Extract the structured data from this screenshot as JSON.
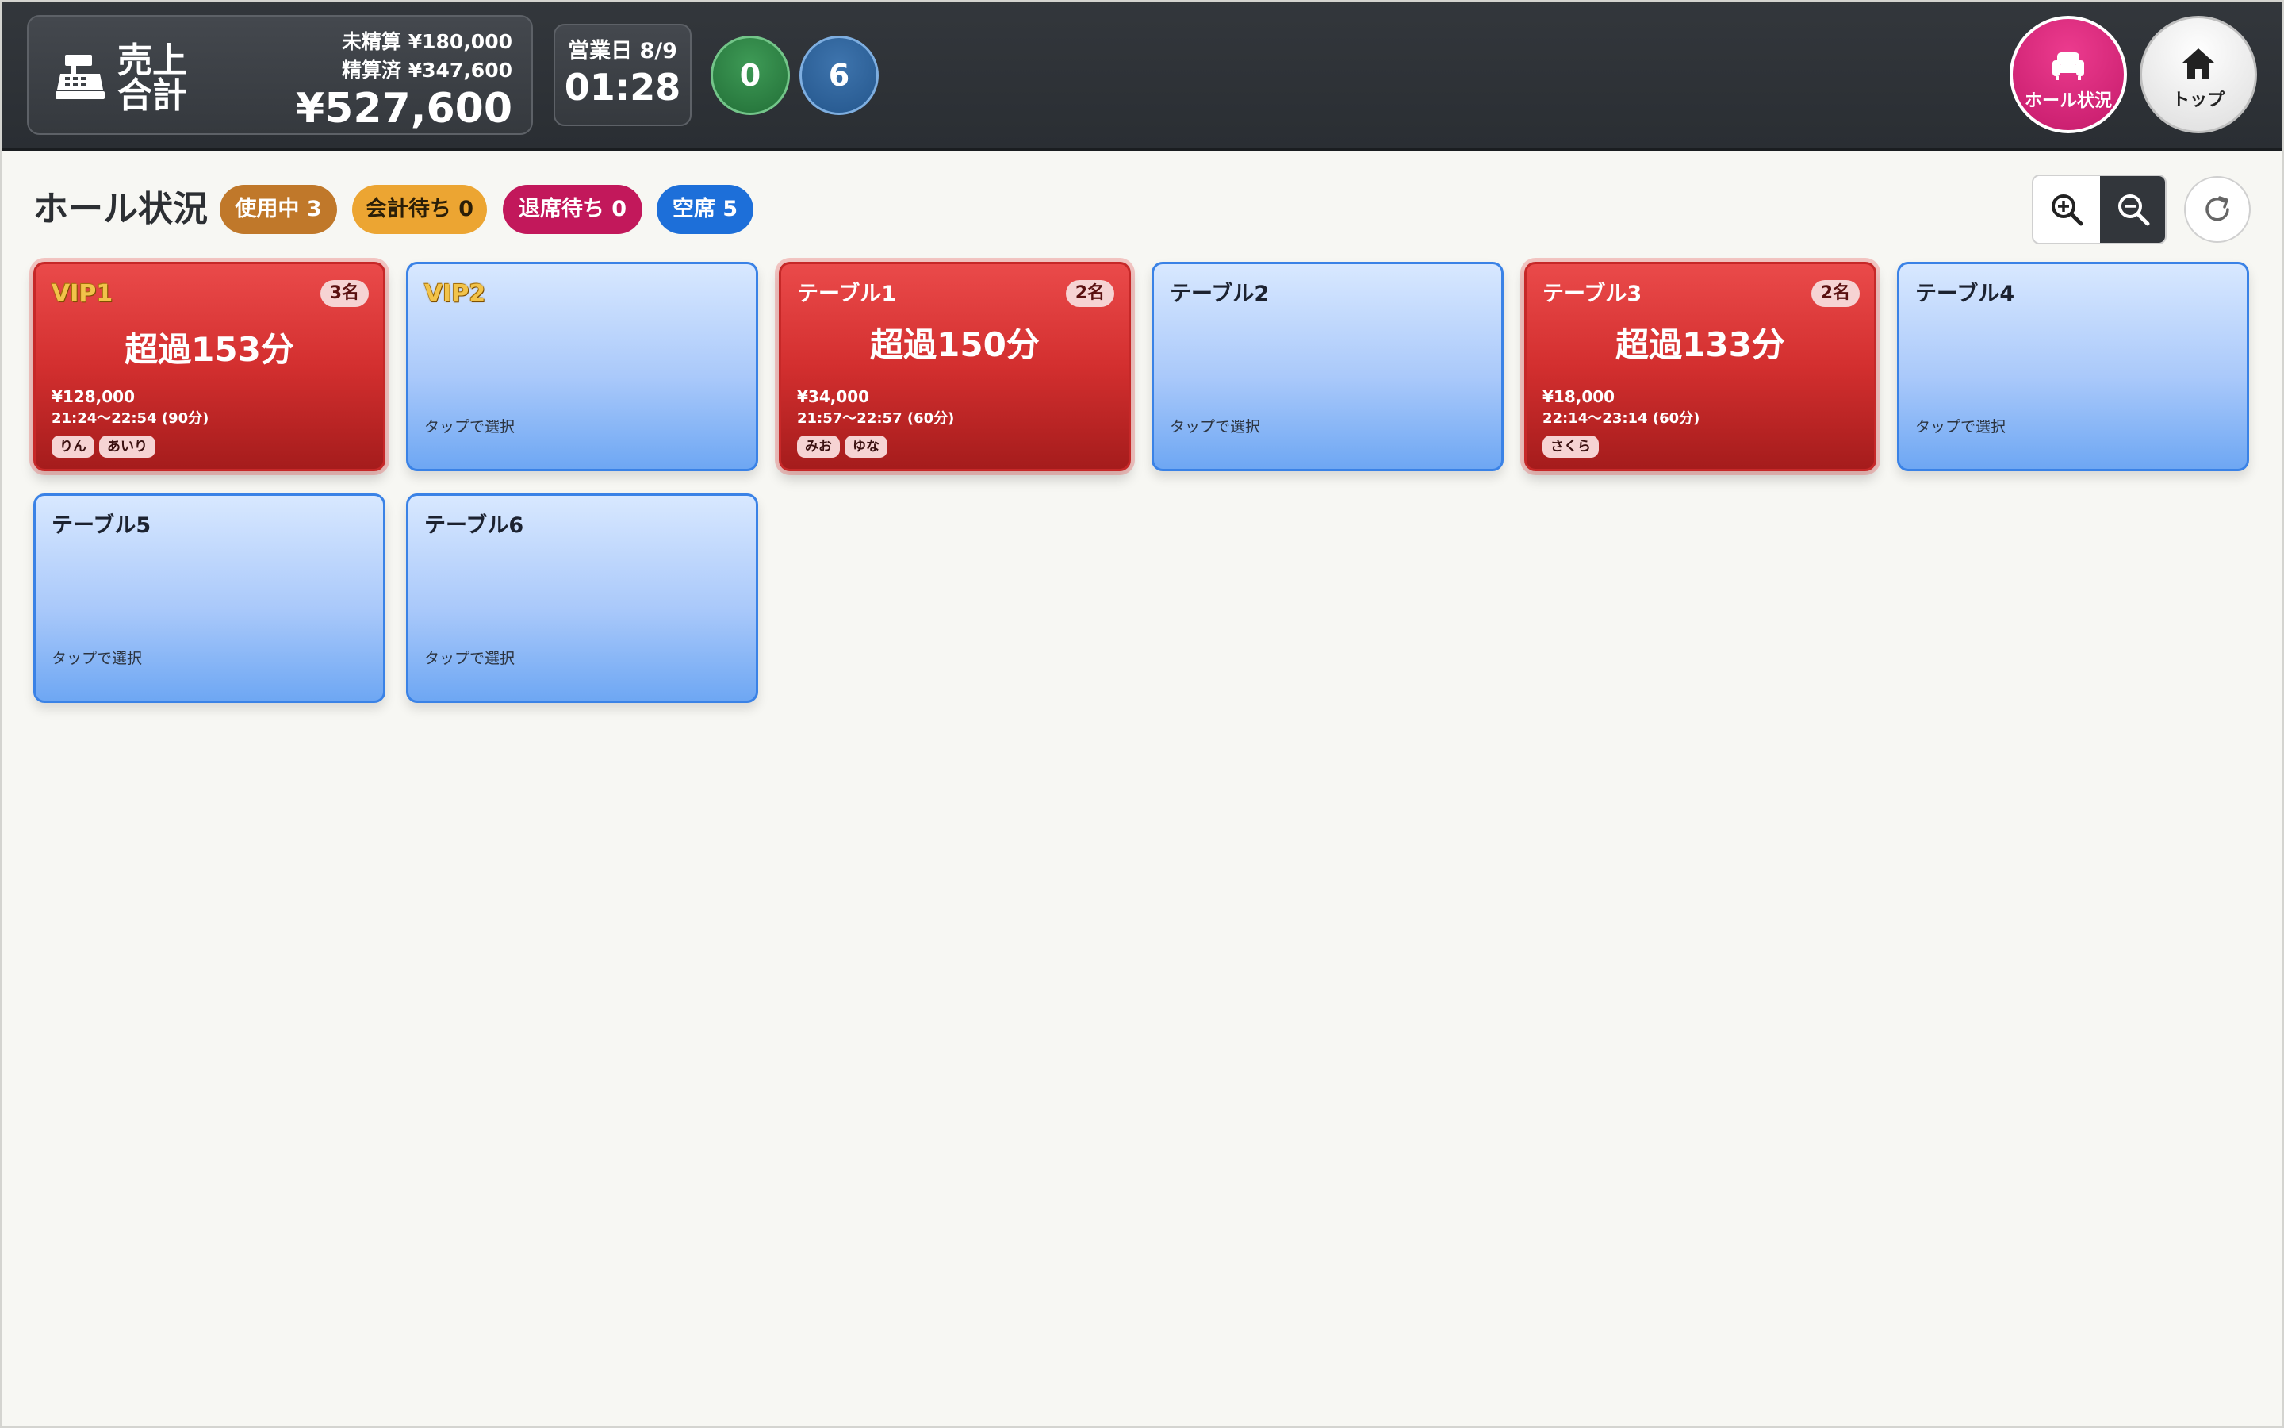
{
  "header": {
    "sales_label_line1": "売上",
    "sales_label_line2": "合計",
    "unsettled": "未精算 ¥180,000",
    "settled": "精算済 ¥347,600",
    "total": "¥527,600",
    "bizday_label": "営業日 8/9",
    "clock": "01:28",
    "count_green": "0",
    "count_blue": "6",
    "nav_hall_label": "ホール状況",
    "nav_top_label": "トップ",
    "nav_hall_icon": "sofa-icon",
    "nav_top_icon": "home-icon",
    "register_icon": "cash-register-icon"
  },
  "hall": {
    "title": "ホール状況",
    "pills": {
      "in_use": "使用中 3",
      "awaiting_bill": "会計待ち 0",
      "awaiting_leave": "退席待ち 0",
      "vacant": "空席 5"
    },
    "zoom_in_icon": "zoom-in-icon",
    "zoom_out_icon": "zoom-out-icon",
    "refresh_icon": "refresh-icon"
  },
  "tables": [
    {
      "name": "VIP1",
      "vip": true,
      "status": "occupied",
      "guests": "3名",
      "overtime": "超過153分",
      "amount": "¥128,000",
      "time": "21:24〜22:54 (90分)",
      "cast": [
        "りん",
        "あいり"
      ]
    },
    {
      "name": "VIP2",
      "vip": true,
      "status": "vacant",
      "hint": "タップで選択"
    },
    {
      "name": "テーブル1",
      "vip": false,
      "status": "occupied",
      "guests": "2名",
      "overtime": "超過150分",
      "amount": "¥34,000",
      "time": "21:57〜22:57 (60分)",
      "cast": [
        "みお",
        "ゆな"
      ]
    },
    {
      "name": "テーブル2",
      "vip": false,
      "status": "vacant",
      "hint": "タップで選択"
    },
    {
      "name": "テーブル3",
      "vip": false,
      "status": "occupied",
      "guests": "2名",
      "overtime": "超過133分",
      "amount": "¥18,000",
      "time": "22:14〜23:14 (60分)",
      "cast": [
        "さくら"
      ]
    },
    {
      "name": "テーブル4",
      "vip": false,
      "status": "vacant",
      "hint": "タップで選択"
    },
    {
      "name": "テーブル5",
      "vip": false,
      "status": "vacant",
      "hint": "タップで選択"
    },
    {
      "name": "テーブル6",
      "vip": false,
      "status": "vacant",
      "hint": "タップで選択"
    }
  ],
  "colors": {
    "occupied": "#d32f2f",
    "vacant": "#6ea7f3",
    "in_use_pill": "#c0782a",
    "awaiting_bill_pill": "#eca532",
    "awaiting_leave_pill": "#c2185b",
    "vacant_pill": "#1d6fd9",
    "nav_hall": "#d81b74"
  }
}
